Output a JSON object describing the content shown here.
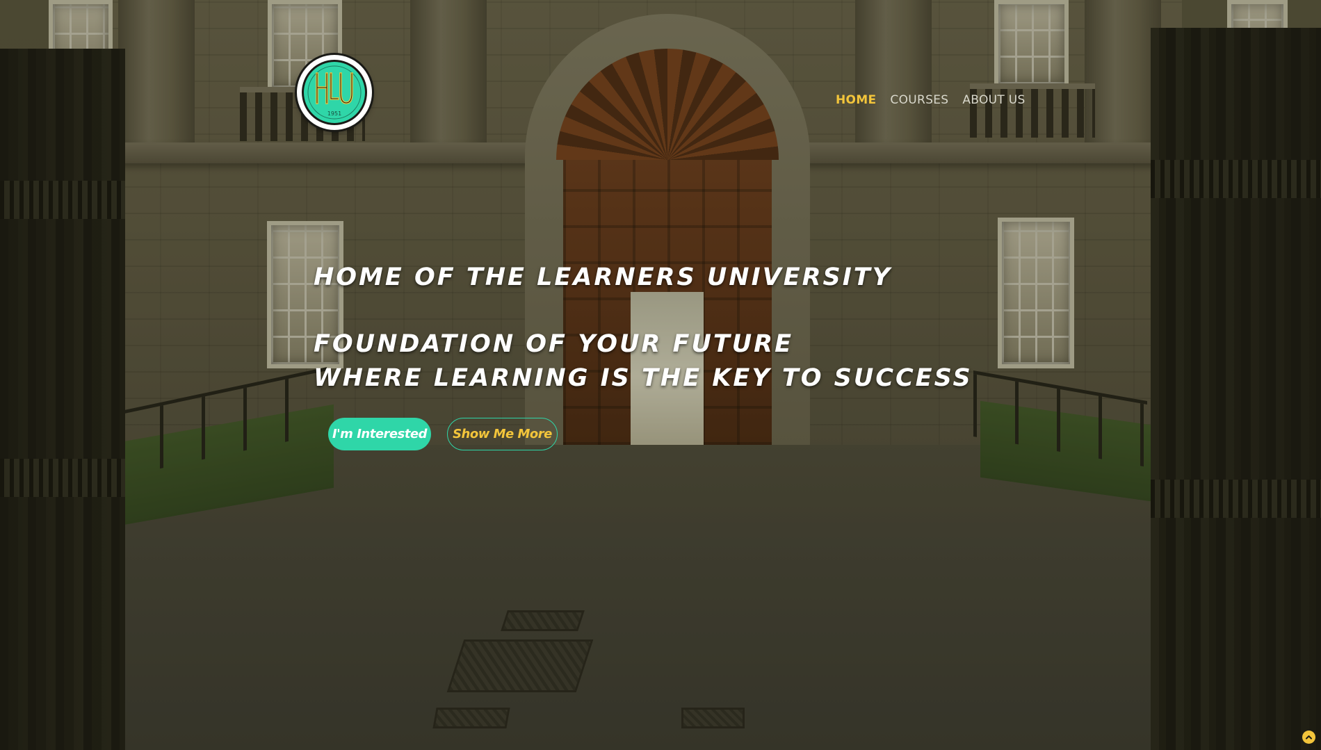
{
  "brand": {
    "logo_letters": "HLU",
    "logo_year": "1951"
  },
  "nav": {
    "items": [
      {
        "label": "HOME",
        "active": true
      },
      {
        "label": "COURSES",
        "active": false
      },
      {
        "label": "ABOUT US",
        "active": false
      }
    ]
  },
  "hero": {
    "headline1": "HOME OF THE LEARNERS UNIVERSITY",
    "headline2": "FOUNDATION OF YOUR FUTURE",
    "headline3": "WHERE LEARNING IS THE KEY TO SUCCESS",
    "primary_button": "I'm Interested",
    "secondary_button": "Show Me More"
  },
  "icons": {
    "scroll_top": "chevron-up-icon",
    "logo": "university-seal-icon"
  },
  "colors": {
    "accent_teal": "#2fd6a8",
    "accent_gold": "#f3c53b",
    "text_light": "#ffffff",
    "nav_text": "#d9d8cc"
  }
}
